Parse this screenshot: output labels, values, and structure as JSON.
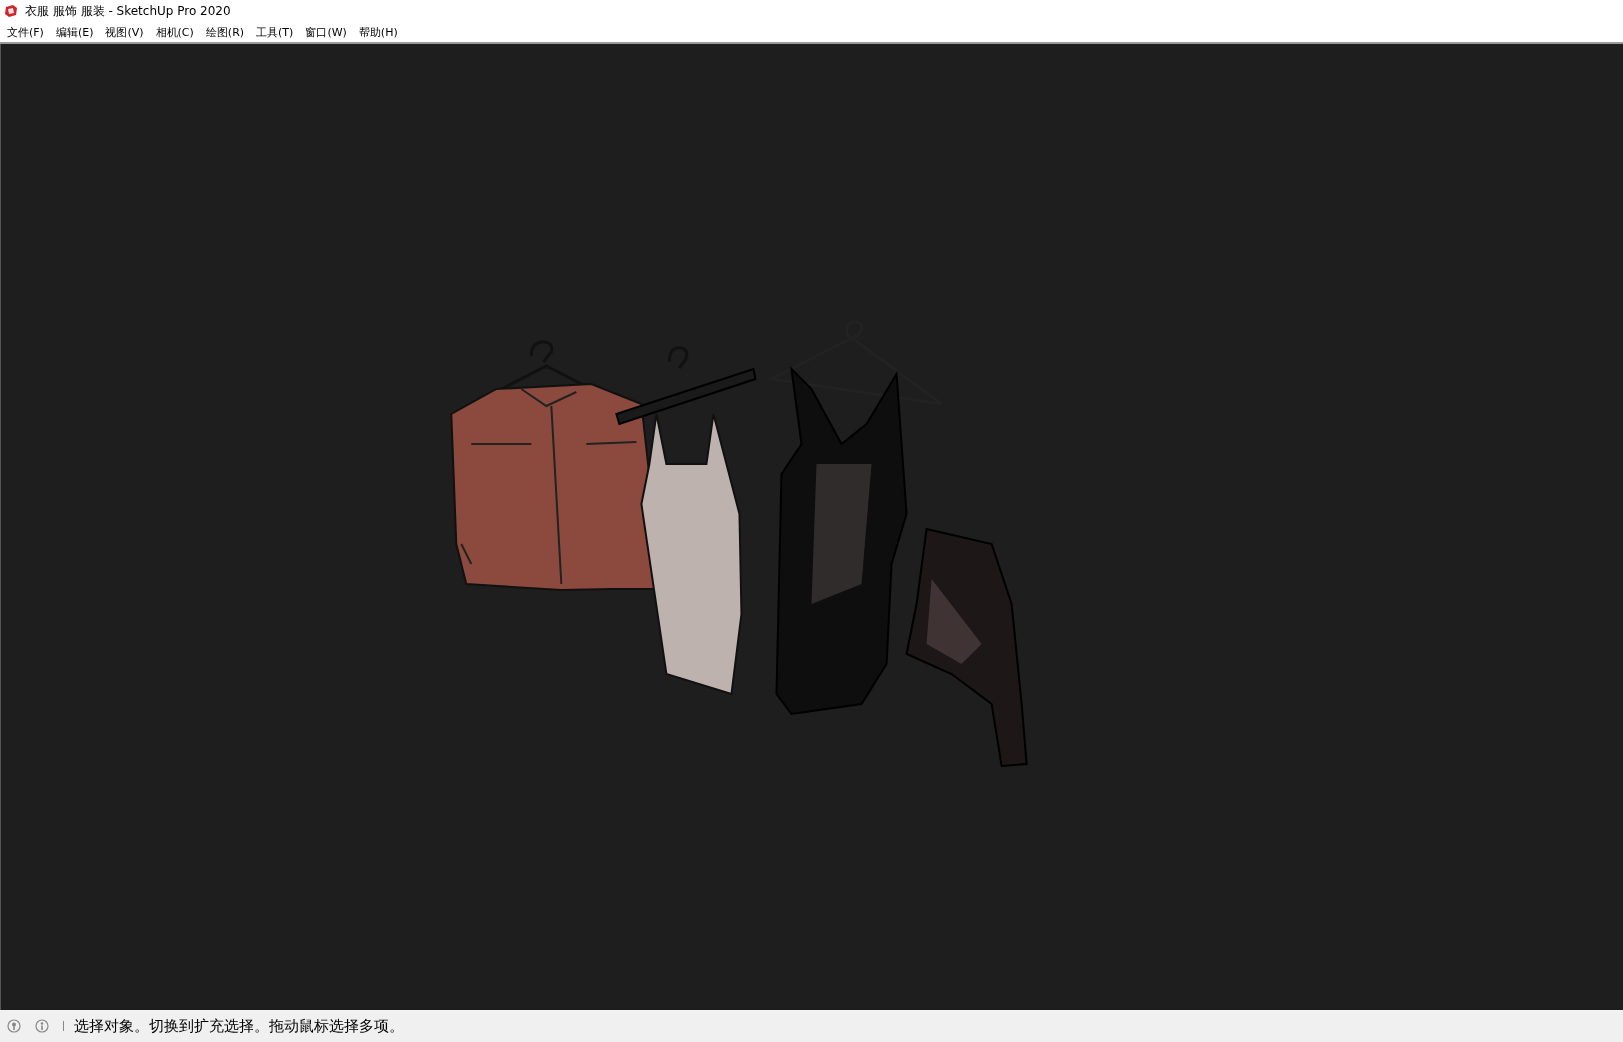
{
  "window": {
    "title": "衣服 服饰 服装 - SketchUp Pro 2020"
  },
  "menu": [
    {
      "label": "文件(F)"
    },
    {
      "label": "编辑(E)"
    },
    {
      "label": "视图(V)"
    },
    {
      "label": "相机(C)"
    },
    {
      "label": "绘图(R)"
    },
    {
      "label": "工具(T)"
    },
    {
      "label": "窗口(W)"
    },
    {
      "label": "帮助(H)"
    }
  ],
  "status_bar": {
    "message": "选择对象。切换到扩充选择。拖动鼠标选择多项。"
  }
}
